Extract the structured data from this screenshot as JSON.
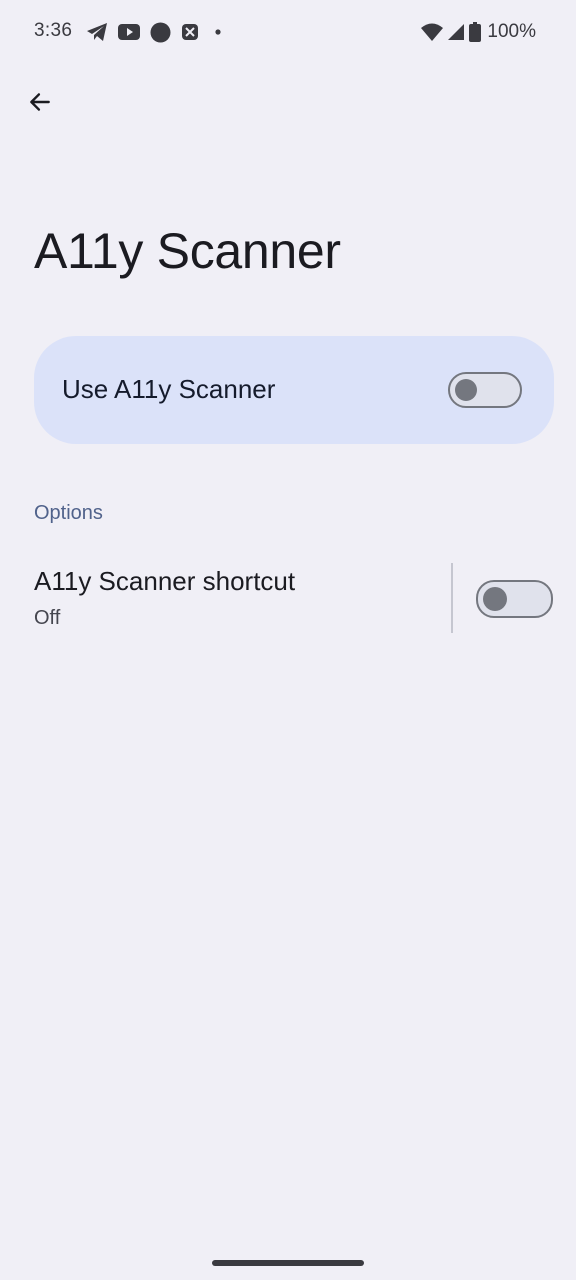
{
  "status_bar": {
    "time": "3:36",
    "notification_icons": [
      "telegram-icon",
      "youtube-icon",
      "circle-app-icon",
      "crossed-box-icon",
      "dot-icon"
    ],
    "system_icons": [
      "wifi-icon",
      "cell-signal-icon",
      "battery-icon"
    ],
    "battery": "100%"
  },
  "header": {
    "back_icon": "arrow-back-icon",
    "title": "A11y Scanner"
  },
  "main_switch": {
    "label": "Use A11y Scanner",
    "state": "off"
  },
  "options": {
    "header": "Options",
    "items": [
      {
        "title": "A11y Scanner shortcut",
        "summary": "Off",
        "state": "off"
      }
    ]
  },
  "colors": {
    "background": "#f0eff6",
    "card": "#dbe2f9",
    "accent_text": "#50628b",
    "switch_outline": "#74777f"
  }
}
